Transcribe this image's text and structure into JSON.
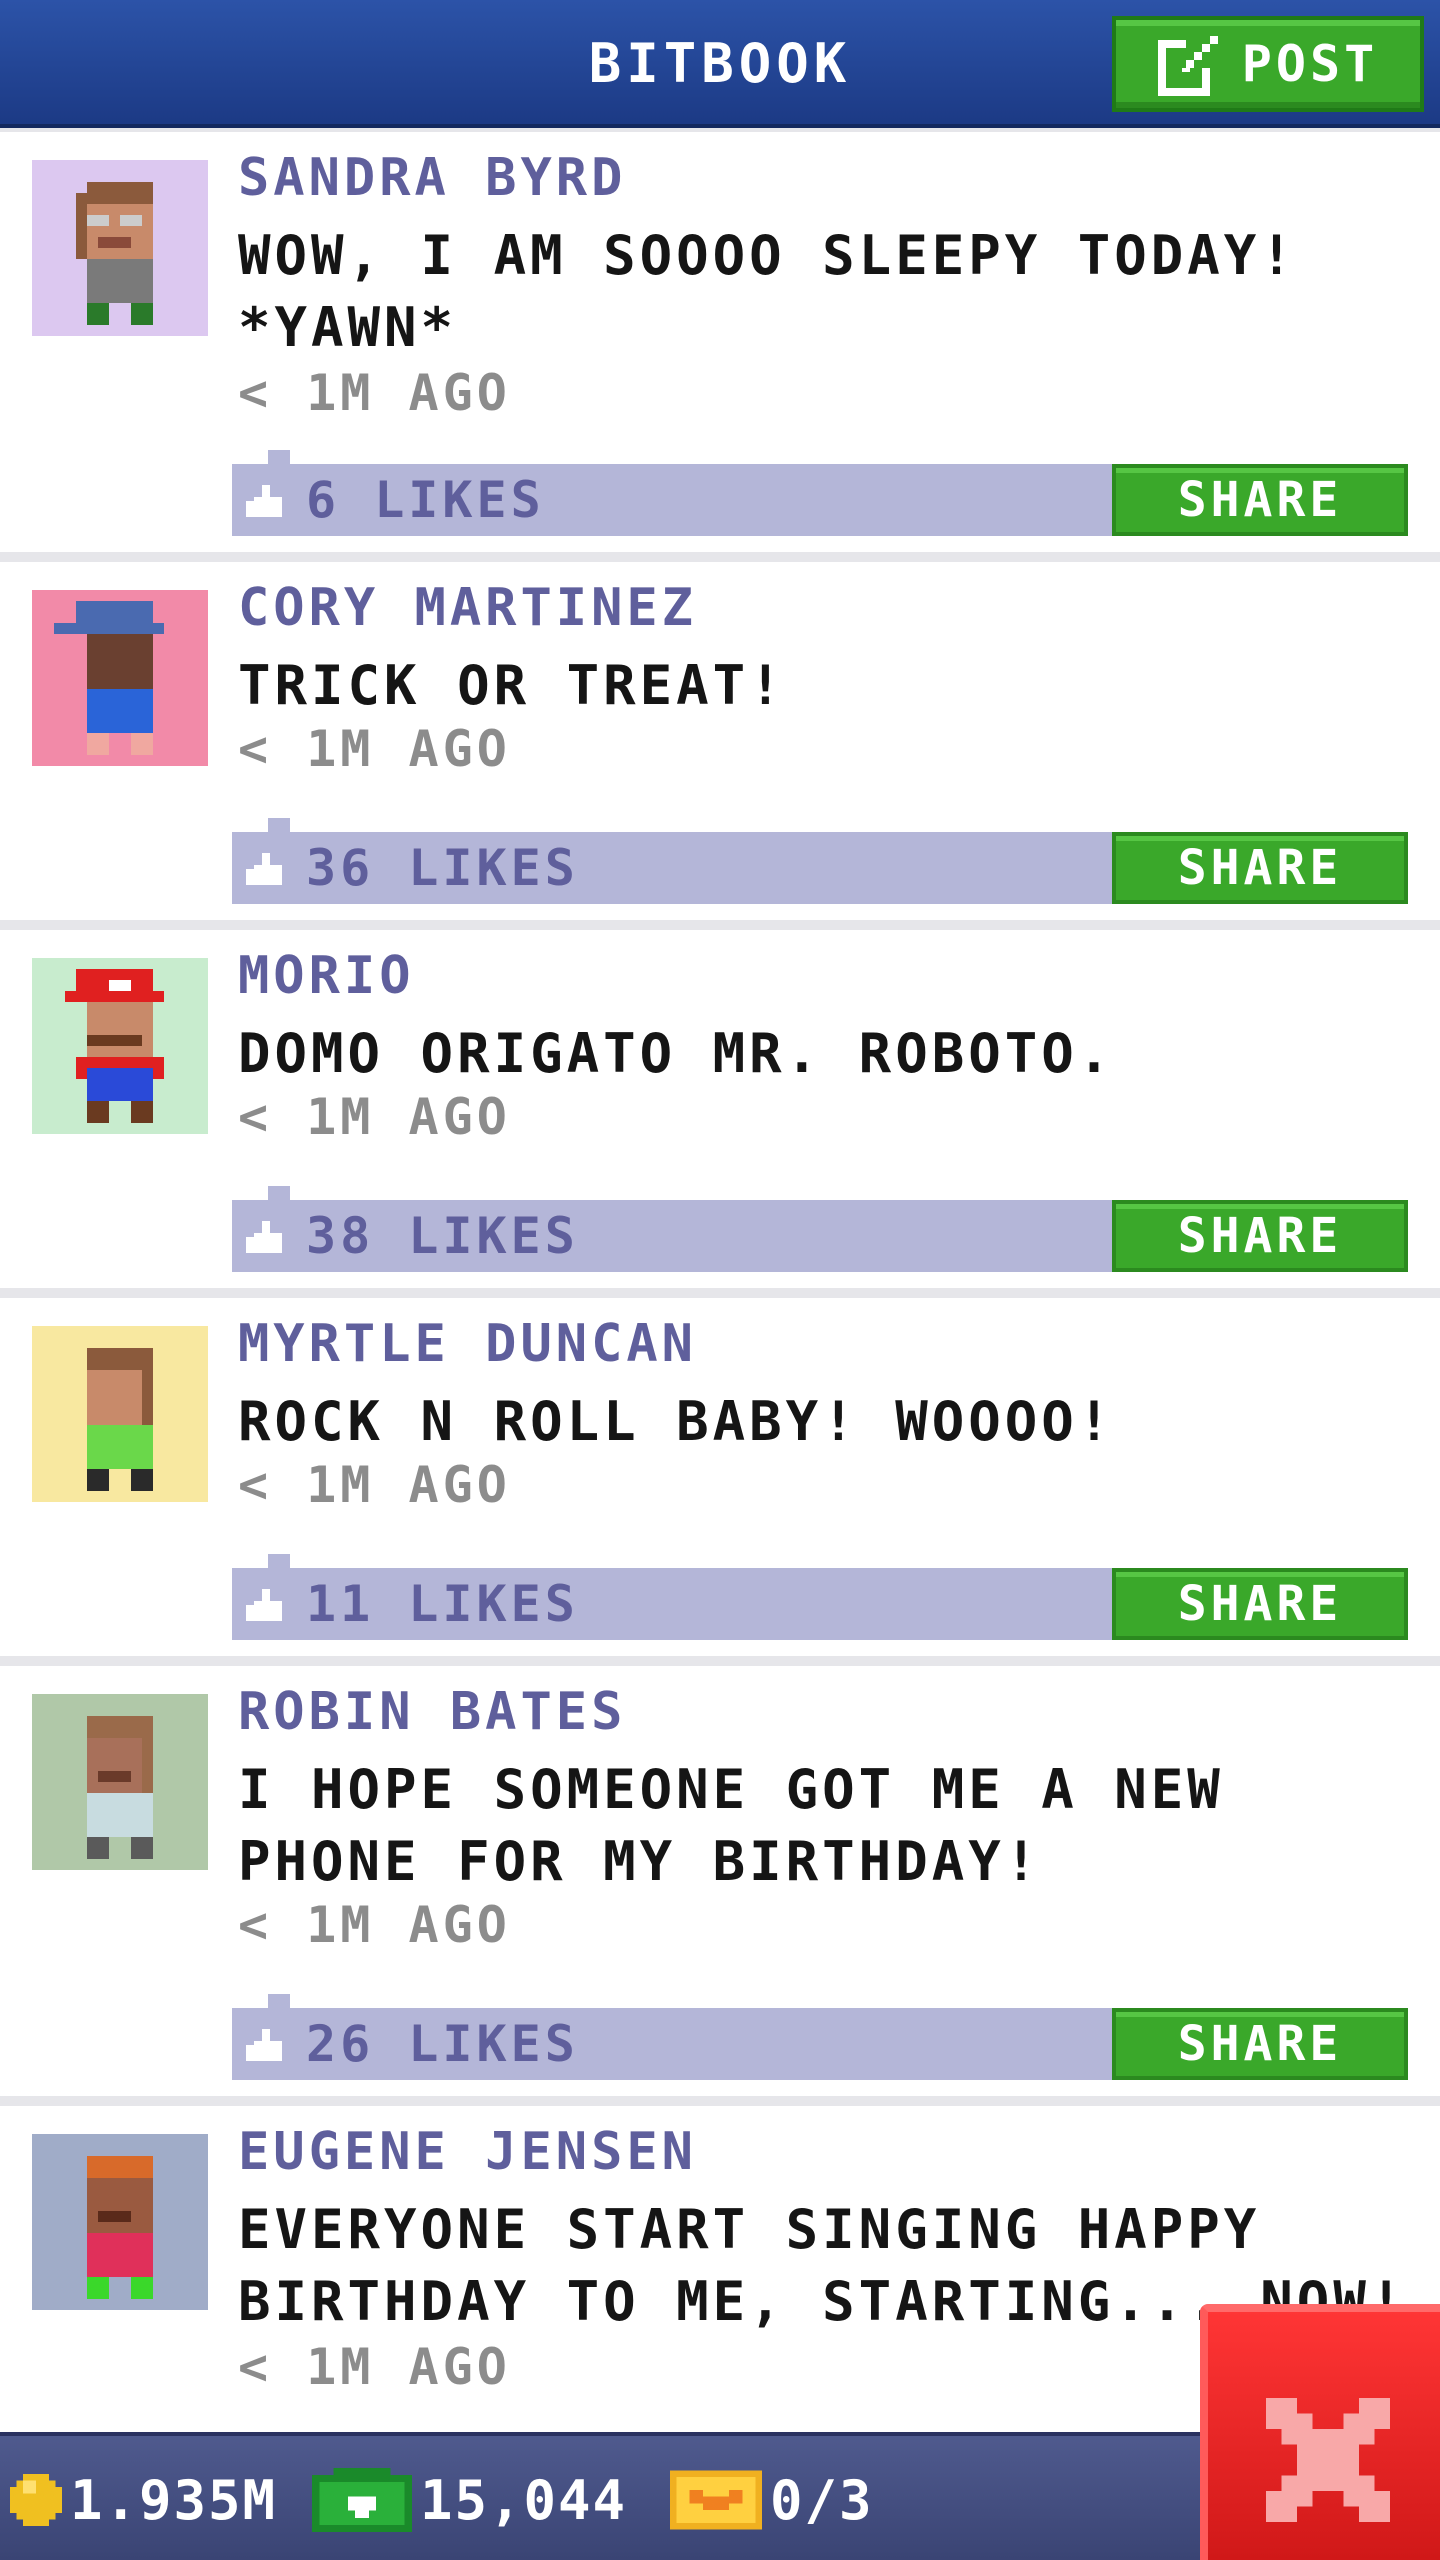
{
  "header": {
    "title": "BITBOOK",
    "post_label": "POST"
  },
  "posts": [
    {
      "name": "SANDRA BYRD",
      "message": "WOW, I AM SOOOO SLEEPY TODAY! *YAWN*",
      "time": "< 1M AGO",
      "likes": "6 LIKES",
      "share": "SHARE",
      "avatar_bg": "#dcc8f0"
    },
    {
      "name": "CORY MARTINEZ",
      "message": "TRICK OR TREAT!",
      "time": "< 1M AGO",
      "likes": "36 LIKES",
      "share": "SHARE",
      "avatar_bg": "#f28aa8"
    },
    {
      "name": "MORIO",
      "message": "DOMO ORIGATO MR. ROBOTO.",
      "time": "< 1M AGO",
      "likes": "38 LIKES",
      "share": "SHARE",
      "avatar_bg": "#c8ecce"
    },
    {
      "name": "MYRTLE DUNCAN",
      "message": "ROCK N ROLL BABY! WOOOO!",
      "time": "< 1M AGO",
      "likes": "11 LIKES",
      "share": "SHARE",
      "avatar_bg": "#f8e8a0"
    },
    {
      "name": "ROBIN BATES",
      "message": "I HOPE SOMEONE GOT ME A NEW PHONE FOR MY BIRTHDAY!",
      "time": "< 1M AGO",
      "likes": "26 LIKES",
      "share": "SHARE",
      "avatar_bg": "#b0c8a8"
    },
    {
      "name": "EUGENE JENSEN",
      "message": "EVERYONE START SINGING HAPPY BIRTHDAY TO ME, STARTING... NOW!",
      "time": "< 1M AGO",
      "avatar_bg": "#a0acc8"
    }
  ],
  "status_bar": {
    "coins": "1.935M",
    "bux": "15,044",
    "tickets": "0/3"
  },
  "colors": {
    "header": "#1c3a85",
    "green_button": "#3aa82a",
    "like_bar": "#b4b6d8",
    "name_text": "#5f5f9c",
    "close_button": "#e02020"
  },
  "icons": [
    "edit-icon",
    "thumbs-up-icon",
    "coin-icon",
    "bux-icon",
    "ticket-icon",
    "close-icon"
  ]
}
